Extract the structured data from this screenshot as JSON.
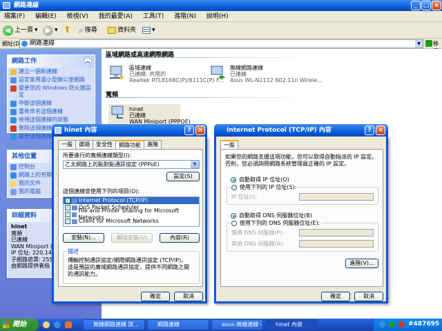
{
  "window": {
    "title": "網路連線"
  },
  "menu": [
    "檔案(F)",
    "編輯(E)",
    "檢視(V)",
    "我的最愛(A)",
    "工具(T)",
    "進階(N)",
    "說明(H)"
  ],
  "toolbar": {
    "back": "上一頁",
    "search": "搜尋",
    "folders": "資料夾"
  },
  "address": {
    "label": "網址(D)",
    "value": "網路連線",
    "go": "移至"
  },
  "left": {
    "tasks_title": "網路工作",
    "tasks": [
      "建立一個新連線",
      "設定家用或小型辦公室網路",
      "變更您的 Windows 防火牆設定",
      "中斷這個連線",
      "重新命名這個連線",
      "檢視這個連線的狀態",
      "刪除這個連線",
      "變更這個連線的設定"
    ],
    "other_title": "其他位置",
    "other": [
      "控制台",
      "網路上的芳鄰",
      "我的文件",
      "我的電腦"
    ],
    "details_title": "詳細資料",
    "details": [
      "hinet",
      "寬頻",
      "已連線",
      "WAN Miniport (P",
      "IP 位址: 220.140.1",
      "子網路遮罩: 255.2",
      "由網路提供者指"
    ]
  },
  "content": {
    "group1": "區域網路或高速網際網路",
    "lan_name": "區域連線",
    "lan_status": "已連線, 共用的",
    "lan_device": "Realtek RTL8168C(P)/8111C(P) F...",
    "wifi_name": "無線網路連線",
    "wifi_status": "已連線",
    "wifi_device": "Asus WL-N2112 802.11n Wirele...",
    "group2": "寬頻",
    "bb_name": "hinet",
    "bb_status": "已連線",
    "bb_device": "WAN Miniport (PPPOE)"
  },
  "dlg1": {
    "title": "hinet 內容",
    "tabs": [
      "一般",
      "選項",
      "安全性",
      "網路功能",
      "進階"
    ],
    "type_label": "所要進行的寬頻連線類型(I):",
    "type_value": "乙太網路上的點對點通訊協定 (PPPoE)",
    "settings_btn": "設定(S)",
    "items_label": "這個連線會使用下列的項目(O):",
    "items": [
      "Internet Protocol (TCP/IP)",
      "QoS Packet Scheduler",
      "File and Printer Sharing for Microsoft Networks",
      "Client for Microsoft Networks"
    ],
    "install_btn": "安裝(N)...",
    "uninstall_btn": "解除安裝(U)",
    "props_btn": "內容(R)",
    "desc_title": "描述",
    "desc_text": "傳輸控制通訊協定/網際網路通訊協定 (TCP/IP)，這是預設的廣域網路通訊協定，提供不同網路之間的通訊能力。",
    "ok_btn": "確定",
    "cancel_btn": "取消"
  },
  "dlg2": {
    "title": "Internet Protocol (TCP/IP) 內容",
    "tab": "一般",
    "intro": "如果您的網路支援這項功能，您可以取得自動指派的 IP 設定。否則，您必須詢問網路系統管理員正確的 IP 設定。",
    "auto_ip": "自動取得 IP 位址(O)",
    "manual_ip": "使用下列的 IP 位址(S):",
    "ip_label": "IP 位址(I):",
    "auto_dns": "自動取得 DNS 伺服器位址(B)",
    "manual_dns": "使用下列的 DNS 伺服器位址(E):",
    "pref_dns": "慣用 DNS 伺服器(P):",
    "alt_dns": "其他 DNS 伺服器(A):",
    "adv_btn": "進階(V)...",
    "ok_btn": "確定",
    "cancel_btn": "取消"
  },
  "taskbar": {
    "start": "開始",
    "items": [
      "無線網路連線 狀...",
      "網路連線",
      "asus-無線連線 - ...",
      "hinet 內容"
    ],
    "watermark": "#487695"
  }
}
